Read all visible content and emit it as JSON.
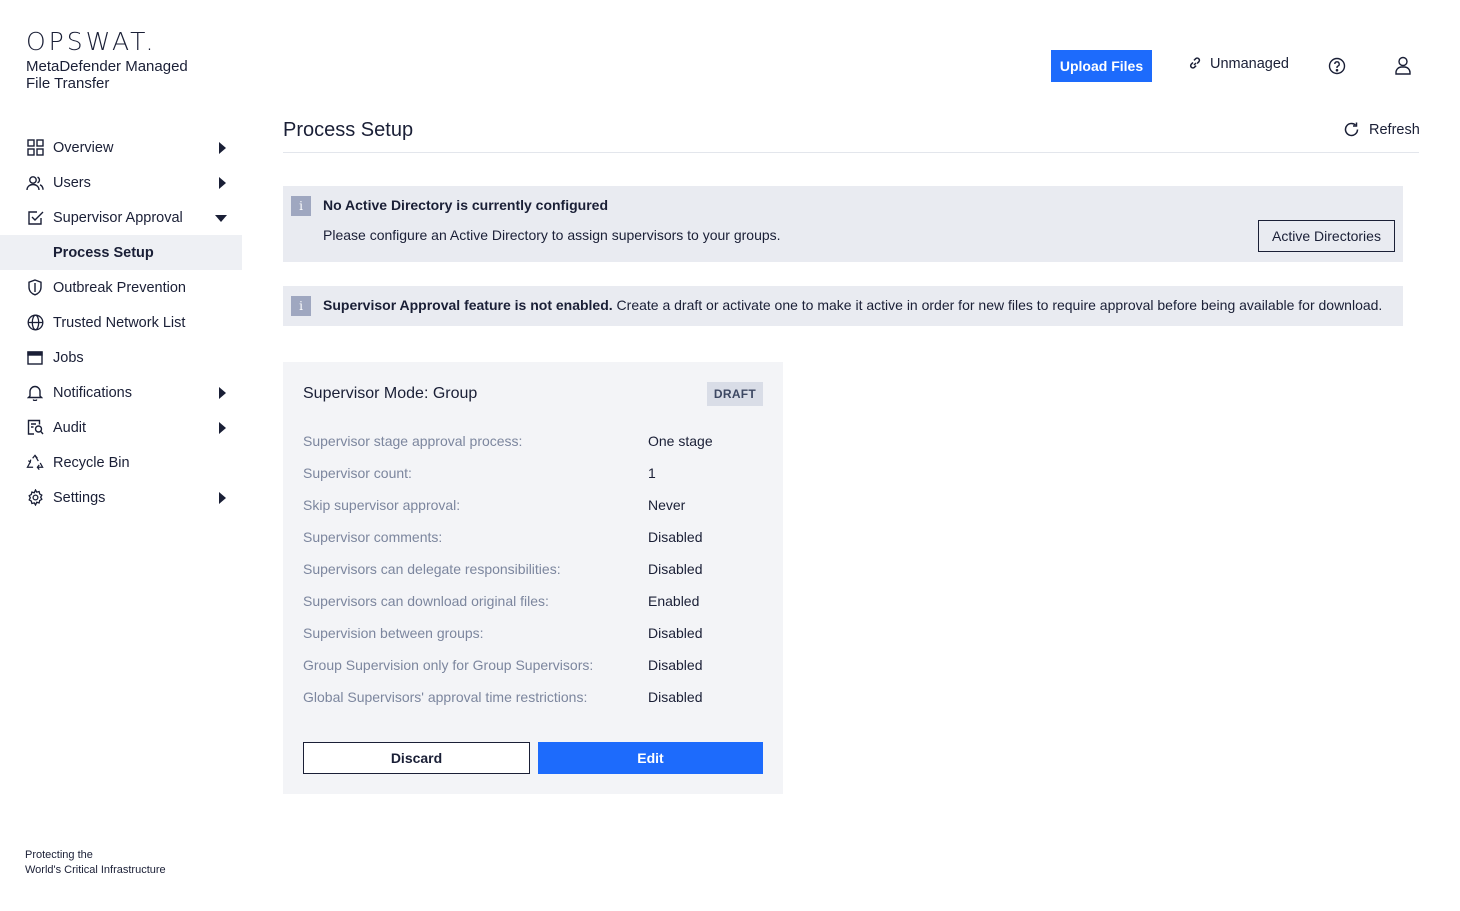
{
  "brand": {
    "logo": "OPSWAT.",
    "product": "MetaDefender Managed File Transfer",
    "tagline_1": "Protecting the",
    "tagline_2": "World's Critical Infrastructure"
  },
  "topbar": {
    "upload_label": "Upload Files",
    "unmanaged_label": "Unmanaged"
  },
  "sidebar": {
    "items": [
      {
        "label": "Overview",
        "icon": "grid-icon",
        "has_submenu": true
      },
      {
        "label": "Users",
        "icon": "users-icon",
        "has_submenu": true
      },
      {
        "label": "Supervisor Approval",
        "icon": "checkbox-icon",
        "has_submenu": true,
        "expanded": true
      },
      {
        "label": "Process Setup",
        "sub": true,
        "selected": true
      },
      {
        "label": "Outbreak Prevention",
        "icon": "shield-icon"
      },
      {
        "label": "Trusted Network List",
        "icon": "globe-icon"
      },
      {
        "label": "Jobs",
        "icon": "window-icon"
      },
      {
        "label": "Notifications",
        "icon": "bell-icon",
        "has_submenu": true
      },
      {
        "label": "Audit",
        "icon": "audit-icon",
        "has_submenu": true
      },
      {
        "label": "Recycle Bin",
        "icon": "recycle-icon"
      },
      {
        "label": "Settings",
        "icon": "gear-icon",
        "has_submenu": true
      }
    ]
  },
  "main": {
    "title": "Process Setup",
    "refresh_label": "Refresh",
    "alert_ad": {
      "title": "No Active Directory is currently configured",
      "text": "Please configure an Active Directory to assign supervisors to your groups.",
      "button_label": "Active Directories"
    },
    "alert_feature": {
      "bold": "Supervisor Approval feature is not enabled.",
      "text": " Create a draft or activate one to make it active in order for new files to require approval before being available for download."
    },
    "card": {
      "title": "Supervisor Mode: Group",
      "badge": "DRAFT",
      "properties": [
        {
          "label": "Supervisor stage approval process:",
          "value": "One stage"
        },
        {
          "label": "Supervisor count:",
          "value": "1"
        },
        {
          "label": "Skip supervisor approval:",
          "value": "Never"
        },
        {
          "label": "Supervisor comments:",
          "value": "Disabled"
        },
        {
          "label": "Supervisors can delegate responsibilities:",
          "value": "Disabled"
        },
        {
          "label": "Supervisors can download original files:",
          "value": "Enabled"
        },
        {
          "label": "Supervision between groups:",
          "value": "Disabled"
        },
        {
          "label": "Group Supervision only for Group Supervisors:",
          "value": "Disabled"
        },
        {
          "label": "Global Supervisors' approval time restrictions:",
          "value": "Disabled"
        }
      ],
      "discard_label": "Discard",
      "edit_label": "Edit"
    }
  },
  "colors": {
    "primary": "#1d6bfc",
    "text": "#1a1f36",
    "muted": "#7c869e",
    "alert_bg": "#e9ebf1",
    "card_bg": "#f3f4f7"
  }
}
